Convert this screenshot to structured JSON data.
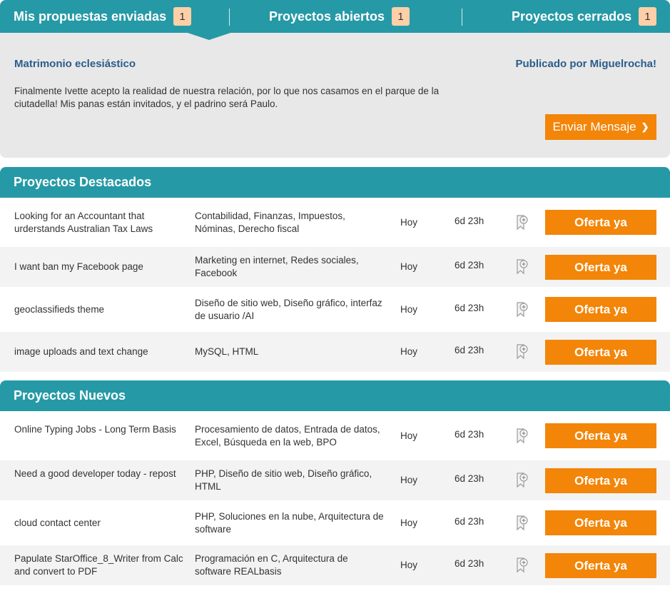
{
  "tabs": [
    {
      "label": "Mis propuestas enviadas",
      "count": "1"
    },
    {
      "label": "Proyectos abiertos",
      "count": "1"
    },
    {
      "label": "Proyectos cerrados",
      "count": "1"
    }
  ],
  "proposal": {
    "title": "Matrimonio eclesiástico",
    "author": "Publicado por Miguelrocha!",
    "description": "Finalmente Ivette acepto la realidad de nuestra relación, por lo que nos casamos en el parque de la ciutadella! Mis panas están invitados, y el padrino será Paulo.",
    "button": "Enviar Mensaje",
    "button_arrow": "❯"
  },
  "featured": {
    "title": "Proyectos Destacados",
    "rows": [
      {
        "title": "Looking for an Accountant that urderstands Australian Tax Laws",
        "skills": "Contabilidad, Finanzas, Impuestos, Nóminas, Derecho fiscal",
        "date": "Hoy",
        "time": "6d 23h",
        "button": "Oferta ya",
        "icon": "bookmark-add-icon"
      },
      {
        "title": "I want ban my Facebook page",
        "skills": "Marketing en internet, Redes sociales, Facebook",
        "date": "Hoy",
        "time": "6d 23h",
        "button": "Oferta ya",
        "icon": "bookmark-add-icon"
      },
      {
        "title": "geoclassifieds theme",
        "skills": "Diseño de sitio web, Diseño gráfico, interfaz de usuario /AI",
        "date": "Hoy",
        "time": "6d 23h",
        "button": "Oferta ya",
        "icon": "bookmark-add-icon"
      },
      {
        "title": "image uploads and text change",
        "skills": "MySQL, HTML",
        "date": "Hoy",
        "time": "6d 23h",
        "button": "Oferta ya",
        "icon": "bookmark-add-icon"
      }
    ]
  },
  "newest": {
    "title": "Proyectos Nuevos",
    "rows": [
      {
        "title": "Online Typing Jobs - Long Term Basis",
        "skills": "Procesamiento de datos, Entrada de datos, Excel, Búsqueda en la web, BPO",
        "date": "Hoy",
        "time": "6d 23h",
        "button": "Oferta ya",
        "icon": "bookmark-add-icon"
      },
      {
        "title": "Need a good developer today - repost",
        "skills": "PHP, Diseño de sitio web, Diseño gráfico, HTML",
        "date": "Hoy",
        "time": "6d 23h",
        "button": "Oferta ya",
        "icon": "bookmark-add-icon"
      },
      {
        "title": "cloud contact center",
        "skills": "PHP, Soluciones en la nube, Arquitectura de software",
        "date": "Hoy",
        "time": "6d 23h",
        "button": "Oferta ya",
        "icon": "bookmark-add-icon"
      },
      {
        "title": "Papulate StarOffice_8_Writer from Calc and convert to PDF",
        "skills": "Programación en C, Arquitectura de software REALbasis",
        "date": "Hoy",
        "time": "6d 23h",
        "button": "Oferta ya",
        "icon": "bookmark-add-icon"
      }
    ]
  },
  "colors": {
    "teal": "#2699a6",
    "orange": "#f38508",
    "badge": "#ffd0a8",
    "link_blue": "#2a5d8c",
    "panel_gray": "#e8e8e8"
  }
}
